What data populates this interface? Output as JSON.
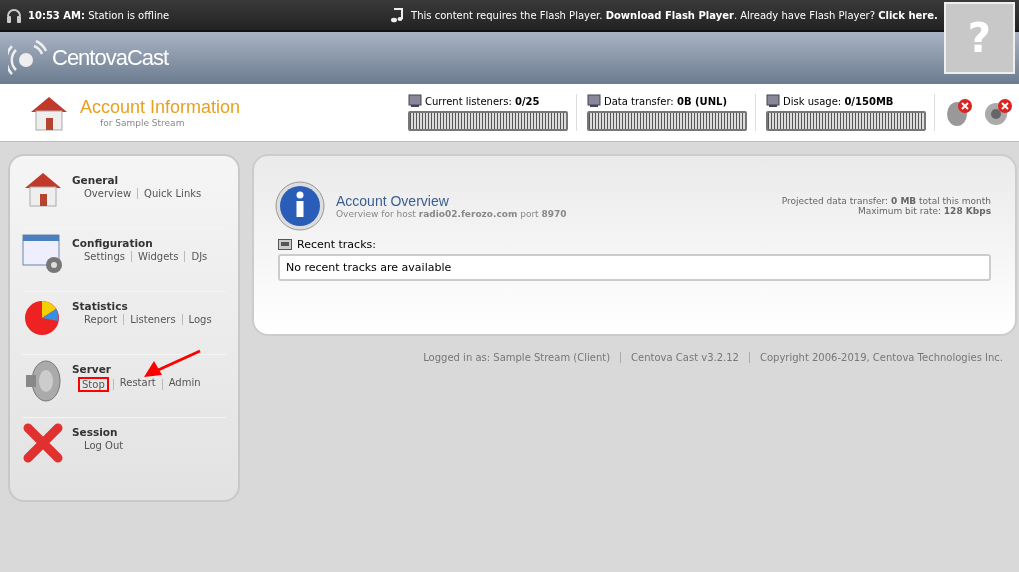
{
  "top_bar": {
    "time": "10:53 AM:",
    "status": "Station is offline",
    "flash_notice": "This content requires the Flash Player. **Download Flash Player**. Already have Flash Player? **Click here.**",
    "help_glyph": "?"
  },
  "logo": {
    "text": "CentovaCast"
  },
  "account": {
    "title": "Account Information",
    "subtitle": "for Sample Stream"
  },
  "meters": [
    {
      "label": "Current listeners:",
      "value": "0/25"
    },
    {
      "label": "Data transfer:",
      "value": "0B (UNL)"
    },
    {
      "label": "Disk usage:",
      "value": "0/150MB"
    }
  ],
  "sidebar": {
    "sections": [
      {
        "kind": "house",
        "title": "General",
        "links": [
          {
            "label": "Overview",
            "highlighted": false
          },
          {
            "label": "Quick Links",
            "highlighted": false
          }
        ]
      },
      {
        "kind": "config",
        "title": "Configuration",
        "links": [
          {
            "label": "Settings",
            "highlighted": false
          },
          {
            "label": "Widgets",
            "highlighted": false
          },
          {
            "label": "DJs",
            "highlighted": false
          }
        ]
      },
      {
        "kind": "pie",
        "title": "Statistics",
        "links": [
          {
            "label": "Report",
            "highlighted": false
          },
          {
            "label": "Listeners",
            "highlighted": false
          },
          {
            "label": "Logs",
            "highlighted": false
          }
        ]
      },
      {
        "kind": "speaker",
        "title": "Server",
        "arrow": true,
        "links": [
          {
            "label": "Stop",
            "highlighted": true
          },
          {
            "label": "Restart",
            "highlighted": false
          },
          {
            "label": "Admin",
            "highlighted": false
          }
        ]
      },
      {
        "kind": "cross",
        "title": "Session",
        "links": [
          {
            "label": "Log Out",
            "highlighted": false
          }
        ]
      }
    ]
  },
  "overview": {
    "title": "Account Overview",
    "subtitle": "Overview for host **radio02.ferozo.com** port **8970**",
    "projected": "Projected data transfer:  **0 MB** total this month",
    "bitrate": "Maximum bit rate: **128 Kbps**",
    "recent_label": "Recent tracks:",
    "recent_empty": "No recent tracks are available"
  },
  "footer": [
    "Logged in as: Sample Stream (Client)",
    "Centova Cast v3.2.12",
    "Copyright 2006-2019, Centova Technologies Inc."
  ]
}
